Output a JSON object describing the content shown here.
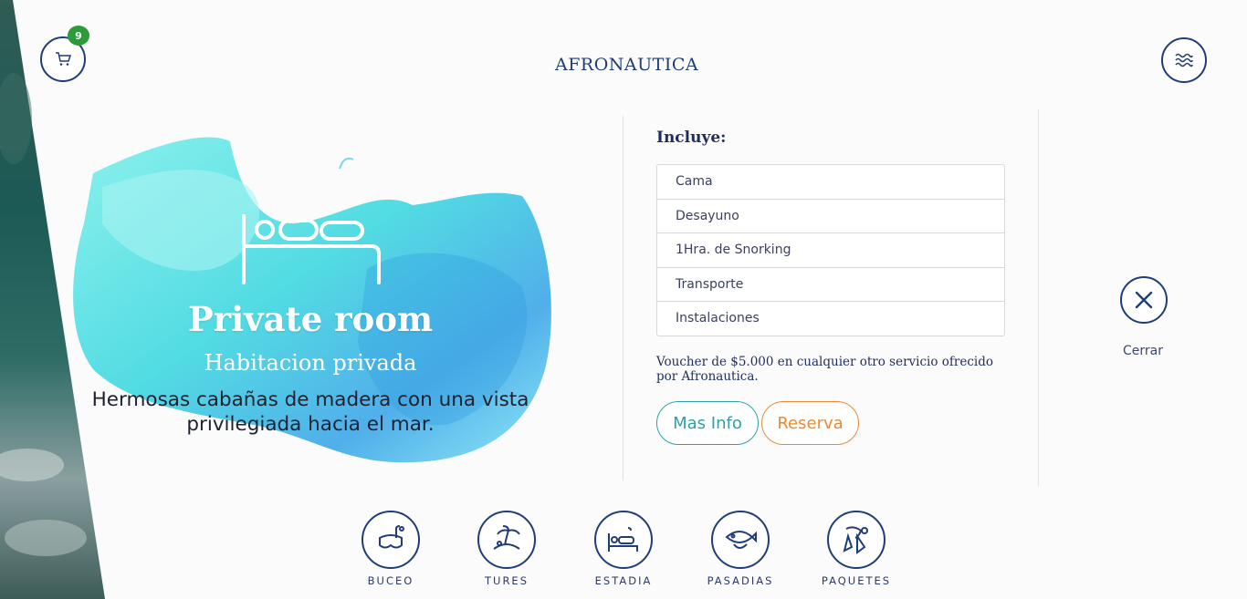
{
  "header": {
    "cart_count": "9",
    "logo": "AFRONAUTICA"
  },
  "room": {
    "title": "Private room",
    "subtitle": "Habitacion privada",
    "description": "Hermosas cabañas de madera con una vista privilegiada hacia el mar."
  },
  "includes": {
    "title": "Incluye:",
    "items": [
      "Cama",
      "Desayuno",
      "1Hra. de Snorking",
      "Transporte",
      "Instalaciones"
    ]
  },
  "voucher": "Voucher de $5.000 en cualquier otro servicio ofrecido por Afronautica.",
  "buttons": {
    "info": "Mas Info",
    "reserve": "Reserva",
    "close": "Cerrar"
  },
  "nav": [
    {
      "label": "BUCEO",
      "icon": "diving-mask-icon"
    },
    {
      "label": "TURES",
      "icon": "palm-beach-icon"
    },
    {
      "label": "ESTADIA",
      "icon": "bed-icon"
    },
    {
      "label": "PASADIAS",
      "icon": "fish-icon"
    },
    {
      "label": "PAQUETES",
      "icon": "flippers-icon"
    }
  ],
  "colors": {
    "primary": "#1f3d78",
    "badge": "#2e9b3b",
    "info": "#2aa3a8",
    "reserve": "#ec8a34"
  }
}
